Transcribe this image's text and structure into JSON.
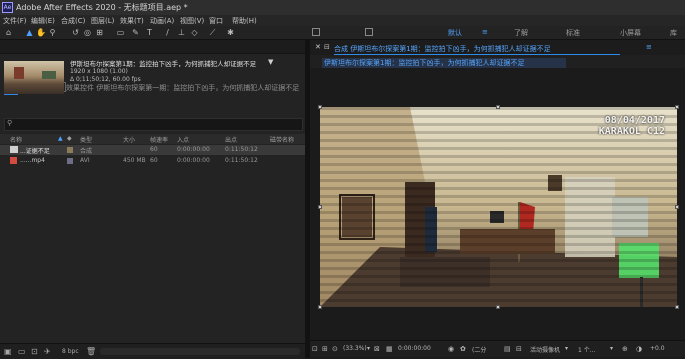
{
  "window": {
    "title": "Adobe After Effects 2020 - 无标题项目.aep *",
    "logo_text": "Ae"
  },
  "menu": [
    "文件(F)",
    "编辑(E)",
    "合成(C)",
    "图层(L)",
    "效果(T)",
    "动画(A)",
    "视图(V)",
    "窗口",
    "帮助(H)"
  ],
  "workspaces": {
    "default": "默认",
    "items": [
      "了解",
      "标准",
      "小屏幕",
      "库"
    ],
    "menu_icon": "≫"
  },
  "project_panel": {
    "tab_label": "项目",
    "effects_tab": "效果控件 伊斯坦布尔探案第一期：监控拍下凶手，为何抓捕犯人却证据不足",
    "selected_name": "伊斯坦布尔探案第1期：监控拍下凶手，为何抓捕犯人却证据不足",
    "meta_line1": "1920 x 1080 (1.00)",
    "meta_line2": "Δ 0;11;50;12, 60.00 fps",
    "search_placeholder": "",
    "columns": [
      "名称",
      "类型",
      "大小",
      "帧速率",
      "入点",
      "出点",
      "磁带名称"
    ],
    "rows": [
      {
        "name": "...证据不足",
        "type": "合成",
        "size": "",
        "fps": "60",
        "in": "0:00:00:00",
        "out": "0:11:50:12",
        "color": "#8a7c5a",
        "selected": true
      },
      {
        "name": "......mp4",
        "type": "AVI",
        "size": "450 MB",
        "fps": "60",
        "in": "0:00:00:00",
        "out": "0:11:50:12",
        "color": "#6d6d86",
        "selected": false
      }
    ],
    "footer_bpc": "8 bpc"
  },
  "comp_panel": {
    "tab_label": "合成 伊斯坦布尔探案第1期：监控拍下凶手，为何抓捕犯人却证据不足",
    "sub_tab": "伊斯坦布尔探案第1期：监控拍下凶手，为何抓捕犯人却证据不足",
    "overlay_date": "08/04/2017",
    "overlay_place": "KARAKOL C12",
    "zoom": "(33.3%)",
    "timecode": "0:00:00:00",
    "resolution": "(二分",
    "camera": "活动摄像机",
    "views": "1 个..."
  },
  "colors": {
    "accent": "#2d8ceb",
    "link": "#55a6ff",
    "bg": "#1d1d1d"
  }
}
